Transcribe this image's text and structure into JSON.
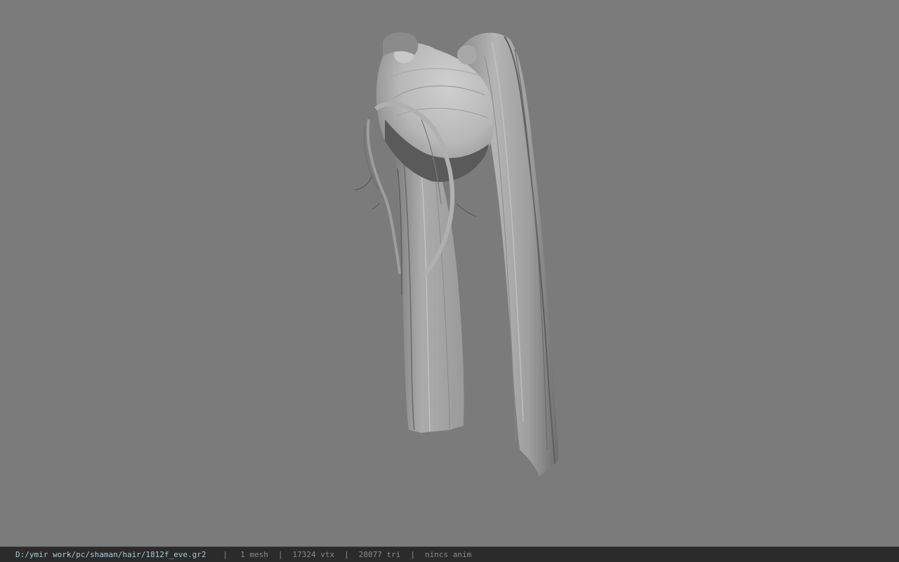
{
  "status_bar": {
    "file_path": "D:/ymir work/pc/shaman/hair/1812f_eve.gr2",
    "separator": "|",
    "mesh_count": "1 mesh",
    "vertex_count": "17324 vtx",
    "triangle_count": "28077 tri",
    "anim_status": "nincs anim"
  },
  "colors": {
    "viewport_background": "#7b7b7b",
    "status_bar_background": "#2b2b2b",
    "status_path_text": "#a8cbd8",
    "status_text": "#8a8a8a"
  }
}
